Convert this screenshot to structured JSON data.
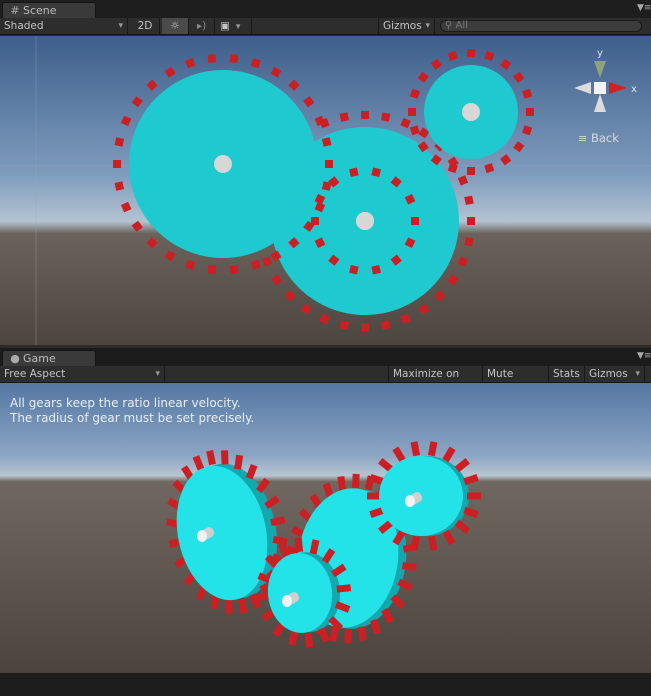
{
  "scene": {
    "tab_label": "Scene",
    "toolbar": {
      "shading": "Shaded",
      "mode_2d": "2D",
      "gizmos": "Gizmos",
      "search_placeholder": "All"
    },
    "orientation_gizmo": {
      "axis_y": "y",
      "axis_x": "x",
      "back_label": "Back"
    }
  },
  "game": {
    "tab_label": "Game",
    "toolbar": {
      "aspect": "Free Aspect",
      "maximize": "Maximize on Play",
      "mute": "Mute audio",
      "stats": "Stats",
      "gizmos": "Gizmos"
    },
    "overlay": {
      "line1": "All gears keep the ratio linear velocity.",
      "line2": "The radius of gear must be set precisely."
    }
  },
  "colors": {
    "gear_body": "#1ec9cf",
    "gear_teeth": "#cc1f24",
    "axle": "#d7d7d7",
    "sky_top": "#4a6a95",
    "horizon": "#b9c7d2",
    "ground": "#4e4640"
  },
  "icons": [
    "grid-icon",
    "sun-icon",
    "speaker-icon",
    "image-icon",
    "search-icon",
    "menu-icon",
    "game-controller-icon",
    "hamburger-icon"
  ]
}
